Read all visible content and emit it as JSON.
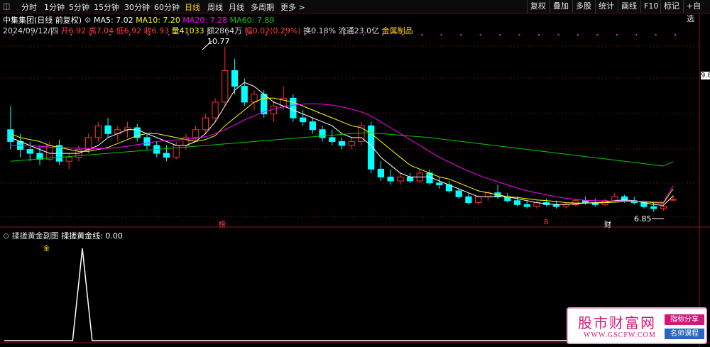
{
  "toolbar": {
    "periods": [
      "分时",
      "1分钟",
      "5分钟",
      "15分钟",
      "30分钟",
      "60分钟",
      "日线",
      "周线",
      "月线",
      "多周期",
      "更多 >"
    ],
    "selected": "日线",
    "right": [
      "复权",
      "叠加",
      "多股",
      "统计",
      "画线",
      "F10",
      "标记",
      "+自选"
    ]
  },
  "header": {
    "stock": "中集集团(日线 前复权)",
    "ma5": "MA5: 7.02",
    "ma10": "MA10: 7.20",
    "ma20": "MA20: 7.28",
    "ma60": "MA60: 7.89"
  },
  "quote": {
    "date": "2024/09/12/四",
    "open": "开6.92",
    "high": "高7.04",
    "low": "低6.92",
    "close": "收6.93",
    "volume": "量41033",
    "amount": "额2864万",
    "change": "幅0.02(0.29%)",
    "turnover": "换0.18%",
    "float": "流通23.0亿",
    "sector": "金属制品"
  },
  "annotations": {
    "high_price": "10.77",
    "low_price": "6.85",
    "axis_price": "9.8",
    "marker1": "榜",
    "marker2": "8",
    "marker3": "财"
  },
  "indicator": {
    "title": "揉搓黄金副图",
    "line": "揉搓黄金线: 0.00",
    "marker": "金"
  },
  "watermark": {
    "title": "股市财富网",
    "url": "WWW.GSCFW.COM",
    "tag1": "指标分享",
    "tag2": "名师课程"
  },
  "colors": {
    "up": "#ff3030",
    "down": "#00ffff",
    "ma5": "#ffffff",
    "ma10": "#ffff00",
    "ma20": "#ff00ff",
    "ma60": "#00cc00",
    "grid": "#8b1a1a"
  },
  "chart_data": {
    "type": "candlestick",
    "price_range": [
      6.5,
      11.0
    ],
    "candles_ohlc": [
      [
        8.7,
        9.3,
        8.2,
        8.4
      ],
      [
        8.4,
        8.6,
        8.0,
        8.2
      ],
      [
        8.2,
        8.4,
        7.9,
        8.1
      ],
      [
        8.1,
        8.3,
        7.8,
        7.95
      ],
      [
        7.95,
        8.4,
        7.9,
        8.3
      ],
      [
        8.3,
        8.45,
        7.8,
        7.9
      ],
      [
        7.9,
        8.1,
        7.7,
        8.0
      ],
      [
        8.0,
        8.3,
        7.9,
        8.2
      ],
      [
        8.2,
        8.6,
        8.1,
        8.5
      ],
      [
        8.5,
        8.9,
        8.4,
        8.8
      ],
      [
        8.8,
        9.0,
        8.5,
        8.6
      ],
      [
        8.6,
        8.8,
        8.4,
        8.7
      ],
      [
        8.7,
        8.9,
        8.5,
        8.75
      ],
      [
        8.75,
        8.85,
        8.4,
        8.5
      ],
      [
        8.5,
        8.6,
        8.2,
        8.3
      ],
      [
        8.3,
        8.4,
        8.0,
        8.1
      ],
      [
        8.1,
        8.3,
        7.9,
        8.0
      ],
      [
        8.0,
        8.4,
        7.95,
        8.3
      ],
      [
        8.3,
        8.6,
        8.2,
        8.5
      ],
      [
        8.5,
        8.8,
        8.4,
        8.7
      ],
      [
        8.7,
        9.1,
        8.6,
        9.0
      ],
      [
        9.0,
        9.5,
        8.9,
        9.4
      ],
      [
        9.4,
        10.8,
        9.3,
        10.2
      ],
      [
        10.2,
        10.5,
        9.6,
        9.8
      ],
      [
        9.8,
        10.0,
        9.3,
        9.4
      ],
      [
        9.4,
        9.7,
        9.2,
        9.6
      ],
      [
        9.6,
        9.7,
        9.0,
        9.1
      ],
      [
        9.1,
        9.4,
        8.9,
        9.3
      ],
      [
        9.3,
        9.8,
        9.2,
        9.5
      ],
      [
        9.5,
        9.6,
        8.9,
        9.0
      ],
      [
        9.0,
        9.2,
        8.8,
        8.9
      ],
      [
        8.9,
        9.0,
        8.6,
        8.7
      ],
      [
        8.7,
        8.8,
        8.4,
        8.5
      ],
      [
        8.5,
        8.7,
        8.3,
        8.4
      ],
      [
        8.4,
        8.5,
        8.2,
        8.3
      ],
      [
        8.3,
        8.5,
        8.2,
        8.4
      ],
      [
        8.4,
        8.9,
        8.3,
        8.8
      ],
      [
        8.8,
        8.9,
        7.6,
        7.7
      ],
      [
        7.7,
        7.9,
        7.4,
        7.5
      ],
      [
        7.5,
        7.7,
        7.3,
        7.4
      ],
      [
        7.4,
        7.6,
        7.3,
        7.5
      ],
      [
        7.5,
        7.6,
        7.35,
        7.4
      ],
      [
        7.4,
        7.7,
        7.35,
        7.6
      ],
      [
        7.6,
        7.7,
        7.3,
        7.35
      ],
      [
        7.35,
        7.5,
        7.2,
        7.3
      ],
      [
        7.3,
        7.4,
        7.1,
        7.15
      ],
      [
        7.15,
        7.2,
        6.95,
        7.0
      ],
      [
        7.0,
        7.1,
        6.8,
        6.85
      ],
      [
        6.85,
        7.05,
        6.8,
        7.0
      ],
      [
        7.0,
        7.15,
        6.9,
        7.1
      ],
      [
        7.1,
        7.3,
        6.95,
        7.0
      ],
      [
        7.0,
        7.1,
        6.85,
        6.9
      ],
      [
        6.9,
        7.0,
        6.75,
        6.8
      ],
      [
        6.8,
        6.9,
        6.7,
        6.75
      ],
      [
        6.75,
        6.9,
        6.7,
        6.85
      ],
      [
        6.85,
        6.95,
        6.75,
        6.8
      ],
      [
        6.8,
        6.9,
        6.7,
        6.75
      ],
      [
        6.75,
        6.85,
        6.7,
        6.8
      ],
      [
        6.8,
        6.95,
        6.75,
        6.9
      ],
      [
        6.9,
        7.0,
        6.8,
        6.85
      ],
      [
        6.85,
        6.95,
        6.75,
        6.8
      ],
      [
        6.8,
        6.95,
        6.75,
        6.9
      ],
      [
        6.9,
        7.1,
        6.85,
        7.0
      ],
      [
        7.0,
        7.05,
        6.85,
        6.9
      ],
      [
        6.9,
        7.0,
        6.8,
        6.85
      ],
      [
        6.85,
        6.9,
        6.7,
        6.75
      ],
      [
        6.75,
        6.85,
        6.62,
        6.7
      ],
      [
        6.7,
        6.8,
        6.65,
        6.75
      ],
      [
        6.92,
        7.04,
        6.92,
        6.93
      ]
    ],
    "ma": {
      "MA5": [
        8.5,
        8.4,
        8.3,
        8.2,
        8.1,
        8.1,
        8.1,
        8.1,
        8.2,
        8.3,
        8.5,
        8.6,
        8.7,
        8.7,
        8.6,
        8.5,
        8.4,
        8.3,
        8.3,
        8.4,
        8.6,
        8.9,
        9.3,
        9.7,
        9.9,
        9.8,
        9.6,
        9.4,
        9.3,
        9.2,
        9.1,
        9.0,
        8.9,
        8.8,
        8.6,
        8.5,
        8.5,
        8.3,
        8.0,
        7.8,
        7.6,
        7.5,
        7.5,
        7.5,
        7.4,
        7.3,
        7.2,
        7.1,
        7.0,
        7.0,
        7.0,
        7.0,
        6.95,
        6.9,
        6.85,
        6.82,
        6.8,
        6.8,
        6.82,
        6.84,
        6.85,
        6.86,
        6.9,
        6.92,
        6.9,
        6.85,
        6.8,
        6.78,
        7.02
      ],
      "MA10": [
        8.6,
        8.5,
        8.45,
        8.4,
        8.3,
        8.25,
        8.2,
        8.15,
        8.15,
        8.2,
        8.25,
        8.35,
        8.45,
        8.55,
        8.6,
        8.6,
        8.55,
        8.5,
        8.45,
        8.4,
        8.45,
        8.55,
        8.8,
        9.0,
        9.2,
        9.4,
        9.5,
        9.5,
        9.45,
        9.4,
        9.3,
        9.2,
        9.1,
        9.0,
        8.9,
        8.8,
        8.75,
        8.6,
        8.4,
        8.2,
        8.0,
        7.8,
        7.7,
        7.6,
        7.5,
        7.45,
        7.35,
        7.25,
        7.15,
        7.1,
        7.05,
        7.0,
        6.98,
        6.95,
        6.92,
        6.9,
        6.88,
        6.85,
        6.84,
        6.84,
        6.84,
        6.85,
        6.86,
        6.88,
        6.88,
        6.87,
        6.85,
        6.84,
        7.2
      ],
      "MA20": [
        8.3,
        8.3,
        8.3,
        8.28,
        8.26,
        8.25,
        8.24,
        8.23,
        8.22,
        8.22,
        8.23,
        8.25,
        8.28,
        8.32,
        8.36,
        8.4,
        8.42,
        8.44,
        8.46,
        8.48,
        8.52,
        8.6,
        8.7,
        8.82,
        8.95,
        9.05,
        9.15,
        9.22,
        9.28,
        9.32,
        9.35,
        9.36,
        9.35,
        9.32,
        9.28,
        9.22,
        9.15,
        9.05,
        8.9,
        8.75,
        8.6,
        8.45,
        8.3,
        8.15,
        8.0,
        7.88,
        7.76,
        7.65,
        7.55,
        7.46,
        7.38,
        7.3,
        7.22,
        7.15,
        7.1,
        7.05,
        7.0,
        6.96,
        6.93,
        6.91,
        6.9,
        6.89,
        6.89,
        6.89,
        6.89,
        6.88,
        6.87,
        6.86,
        7.28
      ],
      "MA60": [
        7.9,
        7.92,
        7.94,
        7.96,
        7.98,
        8.0,
        8.02,
        8.04,
        8.06,
        8.08,
        8.1,
        8.12,
        8.14,
        8.16,
        8.18,
        8.2,
        8.22,
        8.24,
        8.26,
        8.28,
        8.3,
        8.32,
        8.34,
        8.36,
        8.38,
        8.4,
        8.42,
        8.44,
        8.46,
        8.48,
        8.5,
        8.52,
        8.54,
        8.56,
        8.58,
        8.6,
        8.62,
        8.62,
        8.6,
        8.58,
        8.56,
        8.54,
        8.52,
        8.5,
        8.47,
        8.44,
        8.41,
        8.38,
        8.35,
        8.32,
        8.29,
        8.26,
        8.23,
        8.2,
        8.17,
        8.14,
        8.11,
        8.08,
        8.05,
        8.02,
        7.99,
        7.96,
        7.93,
        7.9,
        7.87,
        7.84,
        7.81,
        7.78,
        7.89
      ]
    },
    "indicator_series": [
      0,
      0,
      0,
      0,
      0,
      0,
      0,
      0,
      1,
      0,
      0,
      0,
      0,
      0,
      0,
      0,
      0,
      0,
      0,
      0,
      0,
      0,
      0,
      0,
      0,
      0,
      0,
      0,
      0,
      0,
      0,
      0,
      0,
      0,
      0,
      0,
      0,
      0,
      0,
      0,
      0,
      0,
      0,
      0,
      0,
      0,
      0,
      0,
      0,
      0,
      0,
      0,
      0,
      0,
      0,
      0,
      0,
      0,
      0,
      0,
      0,
      0,
      0,
      0,
      0,
      0,
      0,
      0,
      0
    ]
  }
}
